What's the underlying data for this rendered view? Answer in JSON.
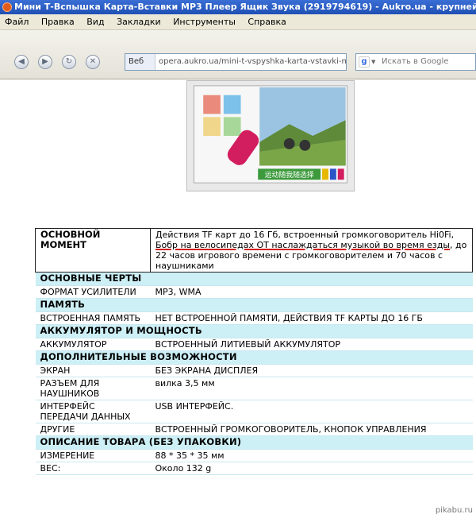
{
  "window": {
    "title": "Мини Т-Вспышка Карта-Вставки MP3 Плеер Ящик Звука (2919794619) - Aukro.ua - крупнейший интернет-аукц"
  },
  "menu": [
    "Файл",
    "Правка",
    "Вид",
    "Закладки",
    "Инструменты",
    "Справка"
  ],
  "toolbar": {
    "back_icon": "back-arrow-icon",
    "forward_icon": "forward-arrow-icon",
    "reload_icon": "reload-icon",
    "site_label": "Веб",
    "url": "opera.aukro.ua/mini-t-vspyshka-karta-vstavki-mp",
    "search_placeholder": "Искать в Google"
  },
  "specs": {
    "top": {
      "key": "ОСНОВНОЙ МОМЕНТ",
      "value_before": "Действия TF карт до 16 Гб, встроенный громкоговоритель Hi0Fi, ",
      "value_underlined": "Бобр на велосипедах ОТ наслаждаться музыкой во время езды",
      "value_after": ", до 22 часов игрового времени с громкоговорителем и 70 часов с наушниками"
    },
    "sections": [
      {
        "title": "ОСНОВНЫЕ ЧЕРТЫ",
        "rows": [
          {
            "k": "ФОРМАТ УСИЛИТЕЛИ",
            "v": "MP3, WMA"
          }
        ]
      },
      {
        "title": "ПАМЯТЬ",
        "rows": [
          {
            "k": "ВСТРОЕННАЯ ПАМЯТЬ",
            "v": "НЕТ ВСТРОЕННОЙ ПАМЯТИ, ДЕЙСТВИЯ TF КАРТЫ ДО 16 ГБ"
          }
        ]
      },
      {
        "title": "АККУМУЛЯТОР И МОЩНОСТЬ",
        "rows": [
          {
            "k": "АККУМУЛЯТОР",
            "v": "ВСТРОЕННЫЙ ЛИТИЕВЫЙ АККУМУЛЯТОР"
          }
        ]
      },
      {
        "title": "ДОПОЛНИТЕЛЬНЫЕ ВОЗМОЖНОСТИ",
        "rows": [
          {
            "k": "ЭКРАН",
            "v": "БЕЗ ЭКРАНА ДИСПЛЕЯ"
          },
          {
            "k": "РАЗЪЕМ ДЛЯ НАУШНИКОВ",
            "v": "вилка 3,5 мм"
          },
          {
            "k": "ИНТЕРФЕЙС ПЕРЕДАЧИ ДАННЫХ",
            "v": "USB ИНТЕРФЕЙС."
          },
          {
            "k": "ДРУГИЕ",
            "v": "ВСТРОЕННЫЙ ГРОМКОГОВОРИТЕЛЬ, КНОПОК УПРАВЛЕНИЯ"
          }
        ]
      },
      {
        "title": "ОПИСАНИЕ ТОВАРА (БЕЗ УПАКОВКИ)",
        "rows": [
          {
            "k": "ИЗМЕРЕНИЕ",
            "v": "88 * 35 * 35 мм"
          },
          {
            "k": "ВЕС:",
            "v": "Около 132 g"
          }
        ]
      }
    ]
  },
  "product_image": {
    "caption": "运动随我随选择"
  },
  "watermark": "pikabu.ru",
  "colors": {
    "section_bg": "#cdeff6",
    "underline": "#d31616",
    "titlebar": "#2a5cc4"
  }
}
